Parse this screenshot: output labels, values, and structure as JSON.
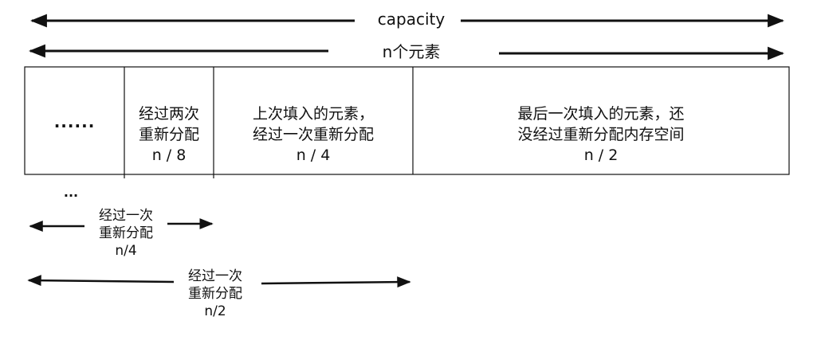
{
  "top": {
    "capacity_label": "capacity",
    "n_label": "n个元素"
  },
  "cells": [
    {
      "line1": "......",
      "line2": "",
      "fraction": ""
    },
    {
      "line1": "经过两次",
      "line2": "重新分配",
      "fraction": "n / 8"
    },
    {
      "line1": "上次填入的元素，",
      "line2": "经过一次重新分配",
      "fraction": "n / 4"
    },
    {
      "line1": "最后一次填入的元素，还",
      "line2": "没经过重新分配内存空间",
      "fraction": "n / 2"
    }
  ],
  "below": {
    "ellipsis": "...",
    "span_quarter": {
      "line1": "经过一次",
      "line2": "重新分配",
      "fraction": "n/4"
    },
    "span_half": {
      "line1": "经过一次",
      "line2": "重新分配",
      "fraction": "n/2"
    }
  },
  "colors": {
    "stroke": "#111111",
    "background": "#ffffff"
  }
}
